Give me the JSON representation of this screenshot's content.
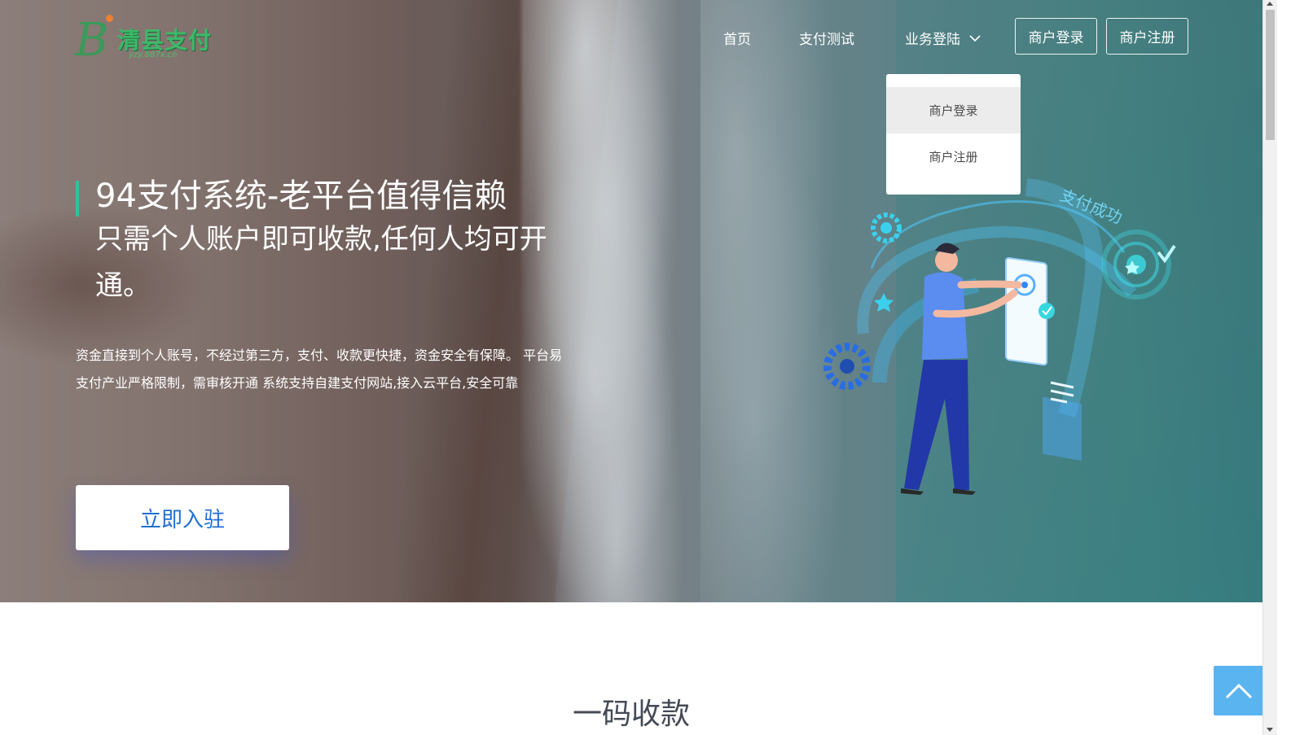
{
  "logo": {
    "letter": "B",
    "text": "清县支付",
    "url": "yzy.887x.cn"
  },
  "nav": {
    "home": "首页",
    "pay_test": "支付测试",
    "business_login": "业务登陆",
    "merchant_login_btn": "商户登录",
    "merchant_register_btn": "商户注册"
  },
  "dropdown": {
    "items": [
      "商户登录",
      "商户注册"
    ],
    "active_index": 0
  },
  "hero": {
    "title": "94支付系统-老平台值得信赖",
    "subtitle": "只需个人账户即可收款,任何人均可开通。",
    "description": "资金直接到个人账号，不经过第三方，支付、收款更快捷，资金安全有保障。 平台易支付产业严格限制，需审核开通 系统支持自建支付网站,接入云平台,安全可靠",
    "cta": "立即入驻",
    "illustration_label": "支付成功"
  },
  "section": {
    "title": "一码收款"
  },
  "colors": {
    "accent_bar": "#2fc1a0",
    "cta_text": "#1f6fd0",
    "back_to_top": "#5ab4f0",
    "logo_green": "#3eb86a"
  },
  "icons": {
    "chevron": "chevron-down-icon",
    "back_to_top": "arrow-up-icon"
  }
}
